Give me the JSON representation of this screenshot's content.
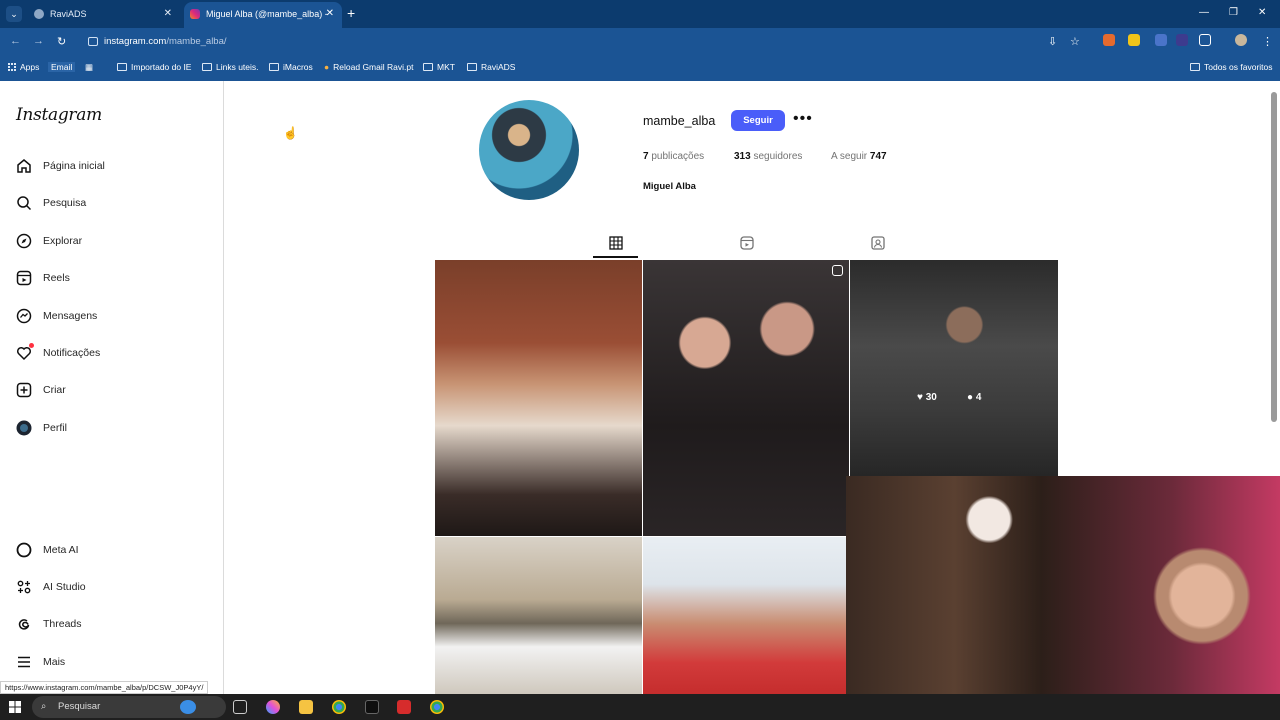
{
  "browser": {
    "tabs": [
      {
        "title": "RaviADS"
      },
      {
        "title": "Miguel Alba (@mambe_alba) -"
      }
    ],
    "url_domain": "instagram.com",
    "url_path": "/mambe_alba/",
    "bookmarks": [
      {
        "label": "Apps"
      },
      {
        "label": "Email"
      },
      {
        "label": "Importado do IE"
      },
      {
        "label": "Links uteis."
      },
      {
        "label": "iMacros"
      },
      {
        "label": "Reload Gmail Ravi.pt"
      },
      {
        "label": "MKT"
      },
      {
        "label": "RaviADS"
      },
      {
        "label": "Todos os favoritos"
      }
    ],
    "status_url": "https://www.instagram.com/mambe_alba/p/DCSW_J0P4yY/"
  },
  "sidebar": {
    "logo": "Instagram",
    "items": [
      {
        "label": "Página inicial",
        "icon": "home-icon"
      },
      {
        "label": "Pesquisa",
        "icon": "search-icon"
      },
      {
        "label": "Explorar",
        "icon": "compass-icon"
      },
      {
        "label": "Reels",
        "icon": "reels-icon"
      },
      {
        "label": "Mensagens",
        "icon": "messenger-icon"
      },
      {
        "label": "Notificações",
        "icon": "heart-icon"
      },
      {
        "label": "Criar",
        "icon": "plus-square-icon"
      },
      {
        "label": "Perfil",
        "icon": "profile-avatar-icon"
      }
    ],
    "bottom_items": [
      {
        "label": "Meta AI",
        "icon": "meta-ai-icon"
      },
      {
        "label": "AI Studio",
        "icon": "ai-studio-icon"
      },
      {
        "label": "Threads",
        "icon": "threads-icon"
      },
      {
        "label": "Mais",
        "icon": "menu-icon"
      }
    ]
  },
  "profile": {
    "username": "mambe_alba",
    "follow_label": "Seguir",
    "more_label": "•••",
    "posts_count": "7",
    "posts_label": "publicações",
    "followers_count": "313",
    "followers_label": "seguidores",
    "following_label": "A seguir",
    "following_count": "747",
    "full_name": "Miguel Alba"
  },
  "posts": [
    {
      "kind": "photo"
    },
    {
      "kind": "reel"
    },
    {
      "kind": "video",
      "likes": "30",
      "comments": "4"
    },
    {
      "kind": "photo"
    },
    {
      "kind": "photo"
    }
  ],
  "taskbar": {
    "search_placeholder": "Pesquisar"
  },
  "colors": {
    "chrome_dark": "#0c3b6e",
    "chrome": "#1b5494",
    "follow_button": "#4a5df9",
    "notification_dot": "#ff3040"
  }
}
